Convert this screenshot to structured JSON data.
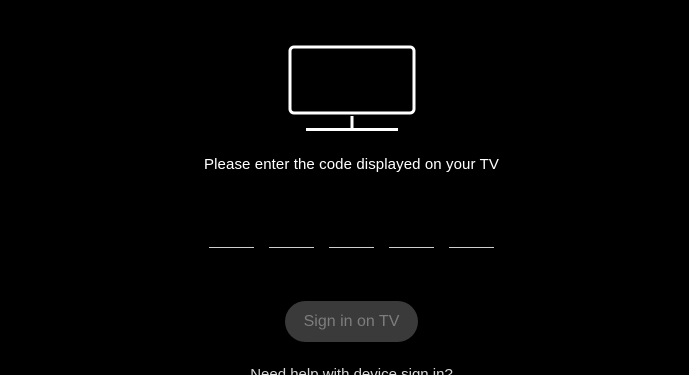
{
  "icon": "tv-icon",
  "prompt_text": "Please enter the code displayed on your TV",
  "code_inputs": [
    {
      "value": "",
      "placeholder": ""
    },
    {
      "value": "",
      "placeholder": ""
    },
    {
      "value": "",
      "placeholder": ""
    },
    {
      "value": "",
      "placeholder": ""
    },
    {
      "value": "",
      "placeholder": ""
    }
  ],
  "sign_in_button": {
    "label": "Sign in on TV",
    "state": "disabled"
  },
  "help_link": {
    "label": "Need help with device sign in?"
  },
  "colors": {
    "background": "#000000",
    "text": "#ffffff",
    "button_bg_disabled": "#3a3a3a",
    "button_text_disabled": "#7d7d7d",
    "input_underline": "#cfcfcf"
  }
}
